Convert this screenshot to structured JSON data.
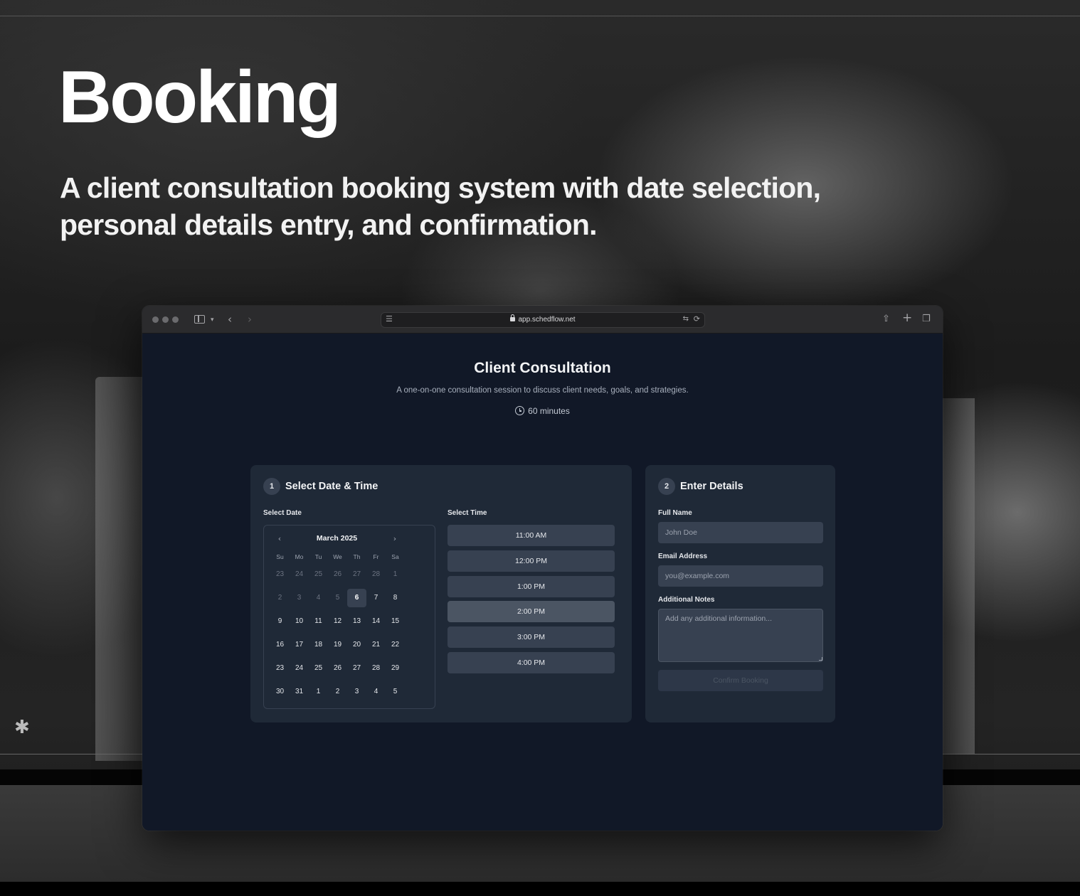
{
  "hero": {
    "title": "Booking",
    "subtitle": "A client consultation booking system with date selection, personal details entry, and confirmation."
  },
  "browser": {
    "url": "app.schedflow.net",
    "icons": [
      "sidebar-icon",
      "back-icon",
      "forward-icon",
      "tab-overview-icon",
      "translate-icon",
      "reload-icon",
      "share-icon",
      "new-tab-icon",
      "tabs-icon"
    ]
  },
  "page": {
    "title": "Client Consultation",
    "description": "A one-on-one consultation session to discuss client needs, goals, and strategies.",
    "duration": "60 minutes"
  },
  "step1": {
    "number": "1",
    "title": "Select Date & Time",
    "date_label": "Select Date",
    "time_label": "Select Time",
    "calendar": {
      "month": "March 2025",
      "weekdays": [
        "Su",
        "Mo",
        "Tu",
        "We",
        "Th",
        "Fr",
        "Sa"
      ],
      "weeks": [
        [
          {
            "d": "23",
            "m": true
          },
          {
            "d": "24",
            "m": true
          },
          {
            "d": "25",
            "m": true
          },
          {
            "d": "26",
            "m": true
          },
          {
            "d": "27",
            "m": true
          },
          {
            "d": "28",
            "m": true
          },
          {
            "d": "1",
            "m": true
          }
        ],
        [
          {
            "d": "2",
            "m": true
          },
          {
            "d": "3",
            "m": true
          },
          {
            "d": "4",
            "m": true
          },
          {
            "d": "5",
            "m": true
          },
          {
            "d": "6",
            "s": true
          },
          {
            "d": "7"
          },
          {
            "d": "8"
          }
        ],
        [
          {
            "d": "9"
          },
          {
            "d": "10"
          },
          {
            "d": "11"
          },
          {
            "d": "12"
          },
          {
            "d": "13"
          },
          {
            "d": "14"
          },
          {
            "d": "15"
          }
        ],
        [
          {
            "d": "16"
          },
          {
            "d": "17"
          },
          {
            "d": "18"
          },
          {
            "d": "19"
          },
          {
            "d": "20"
          },
          {
            "d": "21"
          },
          {
            "d": "22"
          }
        ],
        [
          {
            "d": "23"
          },
          {
            "d": "24"
          },
          {
            "d": "25"
          },
          {
            "d": "26"
          },
          {
            "d": "27"
          },
          {
            "d": "28"
          },
          {
            "d": "29"
          }
        ],
        [
          {
            "d": "30"
          },
          {
            "d": "31"
          },
          {
            "d": "1"
          },
          {
            "d": "2"
          },
          {
            "d": "3"
          },
          {
            "d": "4"
          },
          {
            "d": "5"
          }
        ]
      ],
      "selected_day": "6"
    },
    "times": [
      "11:00 AM",
      "12:00 PM",
      "1:00 PM",
      "2:00 PM",
      "3:00 PM",
      "4:00 PM"
    ],
    "active_time": "2:00 PM"
  },
  "step2": {
    "number": "2",
    "title": "Enter Details",
    "name_label": "Full Name",
    "name_placeholder": "John Doe",
    "email_label": "Email Address",
    "email_placeholder": "you@example.com",
    "notes_label": "Additional Notes",
    "notes_placeholder": "Add any additional information...",
    "confirm_label": "Confirm Booking"
  }
}
